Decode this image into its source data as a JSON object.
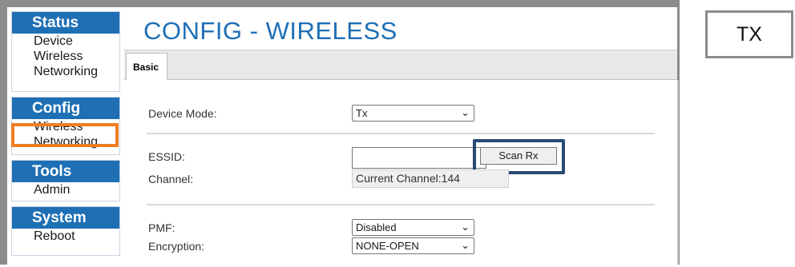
{
  "sidebar": {
    "status": {
      "heading": "Status",
      "items": [
        "Device",
        "Wireless",
        "Networking"
      ]
    },
    "config": {
      "heading": "Config",
      "items": [
        "Wireless",
        "Networking"
      ]
    },
    "tools": {
      "heading": "Tools",
      "items": [
        "Admin"
      ]
    },
    "system": {
      "heading": "System",
      "items": [
        "Reboot"
      ]
    }
  },
  "main": {
    "title": "CONFIG - WIRELESS",
    "tab": "Basic",
    "device_mode": {
      "label": "Device Mode:",
      "value": "Tx"
    },
    "essid": {
      "label": "ESSID:",
      "value": "",
      "button": "Scan Rx"
    },
    "channel": {
      "label": "Channel:",
      "value": "Current Channel:144"
    },
    "pmf": {
      "label": "PMF:",
      "value": "Disabled"
    },
    "encryption": {
      "label": "Encryption:",
      "value": "NONE-OPEN"
    }
  },
  "tx_label": "TX",
  "icons": {
    "dropdown": "chevron-down-icon"
  },
  "colors": {
    "accent": "#1f6fb5",
    "highlight_orange": "#ef7d22",
    "highlight_navy": "#284a74"
  }
}
